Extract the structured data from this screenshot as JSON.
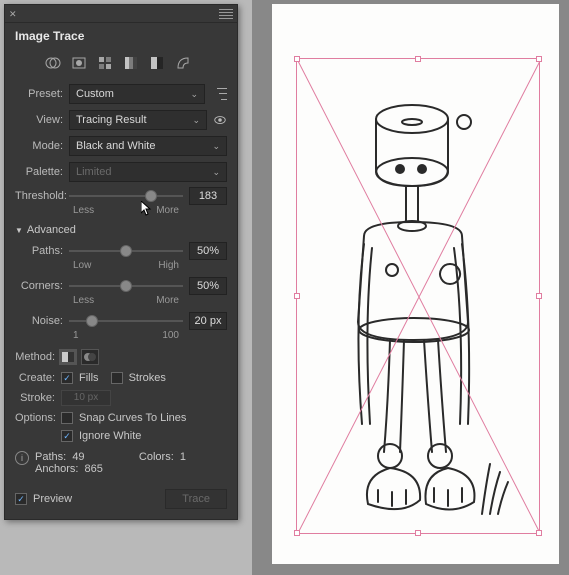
{
  "panel": {
    "title": "Image Trace",
    "preset": {
      "label": "Preset:",
      "value": "Custom"
    },
    "view": {
      "label": "View:",
      "value": "Tracing Result"
    },
    "mode": {
      "label": "Mode:",
      "value": "Black and White"
    },
    "palette": {
      "label": "Palette:",
      "value": "Limited"
    },
    "threshold": {
      "label": "Threshold:",
      "value": "183",
      "min": "Less",
      "max": "More",
      "pct": 72
    },
    "advanced": "Advanced",
    "paths": {
      "label": "Paths:",
      "value": "50%",
      "min": "Low",
      "max": "High",
      "pct": 50
    },
    "corners": {
      "label": "Corners:",
      "value": "50%",
      "min": "Less",
      "max": "More",
      "pct": 50
    },
    "noise": {
      "label": "Noise:",
      "value": "20 px",
      "min": "1",
      "max": "100",
      "pct": 20
    },
    "method": "Method:",
    "create": {
      "label": "Create:",
      "fills": "Fills",
      "strokes": "Strokes"
    },
    "stroke": {
      "label": "Stroke:",
      "value": "10 px"
    },
    "options": {
      "label": "Options:",
      "snap": "Snap Curves To Lines",
      "ignore": "Ignore White"
    },
    "stats": {
      "paths_label": "Paths:",
      "paths_val": "49",
      "anchors_label": "Anchors:",
      "anchors_val": "865",
      "colors_label": "Colors:",
      "colors_val": "1"
    },
    "preview": "Preview",
    "trace": "Trace"
  }
}
